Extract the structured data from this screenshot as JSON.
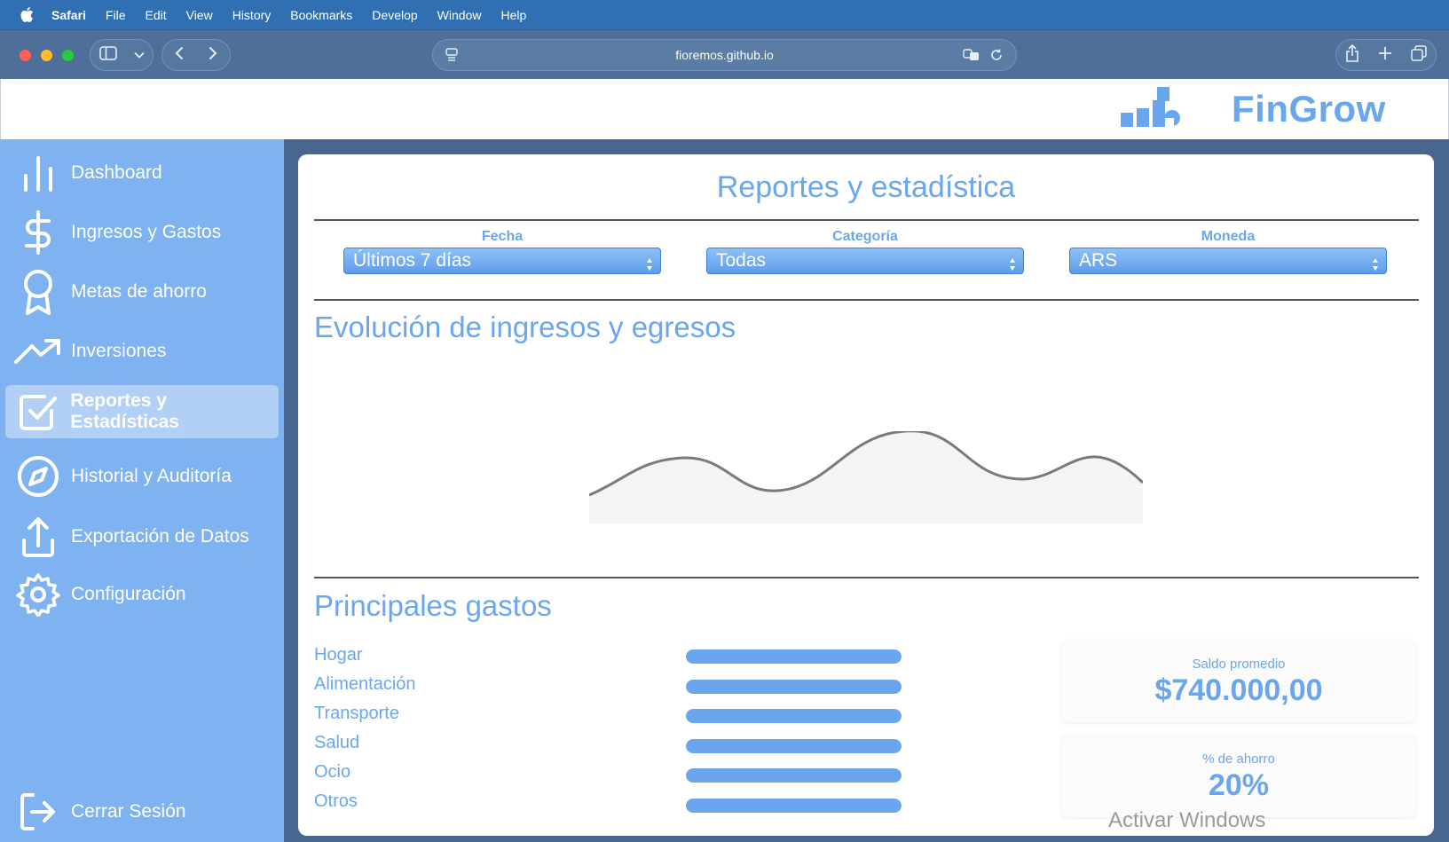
{
  "menubar": {
    "app": "Safari",
    "items": [
      "File",
      "Edit",
      "View",
      "History",
      "Bookmarks",
      "Develop",
      "Window",
      "Help"
    ]
  },
  "browser": {
    "url": "fioremos.github.io"
  },
  "brand": {
    "name": "FinGrow",
    "color": "#6aa6ee"
  },
  "sidebar": {
    "items": [
      {
        "label": "Dashboard",
        "icon": "bar-chart-icon"
      },
      {
        "label": "Ingresos y Gastos",
        "icon": "dollar-icon"
      },
      {
        "label": "Metas de ahorro",
        "icon": "award-icon"
      },
      {
        "label": "Inversiones",
        "icon": "trending-up-icon"
      },
      {
        "label": "Reportes y Estadísticas",
        "icon": "check-square-icon",
        "active": true
      },
      {
        "label": "Historial y Auditoría",
        "icon": "compass-icon"
      },
      {
        "label": "Exportación de Datos",
        "icon": "upload-icon"
      },
      {
        "label": "Configuración",
        "icon": "gear-icon"
      }
    ],
    "logout": {
      "label": "Cerrar Sesión",
      "icon": "logout-icon"
    }
  },
  "main": {
    "title": "Reportes y estadística",
    "filters": [
      {
        "label": "Fecha",
        "value": "Últimos 7 días"
      },
      {
        "label": "Categoría",
        "value": "Todas"
      },
      {
        "label": "Moneda",
        "value": "ARS"
      }
    ],
    "evolution_title": "Evolución de ingresos y egresos",
    "expenses_title": "Principales gastos",
    "expenses": [
      {
        "label": "Hogar",
        "fill": 1.0
      },
      {
        "label": "Alimentación",
        "fill": 1.0
      },
      {
        "label": "Transporte",
        "fill": 1.0
      },
      {
        "label": "Salud",
        "fill": 1.0
      },
      {
        "label": "Ocio",
        "fill": 1.0
      },
      {
        "label": "Otros",
        "fill": 1.0
      }
    ],
    "stats": [
      {
        "label": "Saldo promedio",
        "value": "$740.000,00"
      },
      {
        "label": "% de ahorro",
        "value": "20%"
      }
    ]
  },
  "watermark": "Activar Windows"
}
